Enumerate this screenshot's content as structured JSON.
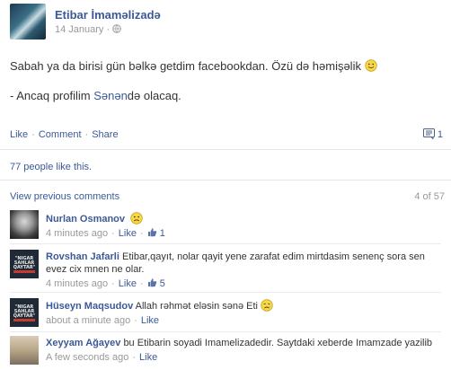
{
  "post": {
    "author": "Etibar İmaməlizadə",
    "date": "14 January",
    "meta_sep": "·",
    "line1": "Sabah ya da birisi gün bəlkə getdim facebookdan. Özü də həmişəlik",
    "line2_pre": "- Ancaq profilim ",
    "line2_mention": "Sənən",
    "line2_post": "də olacaq."
  },
  "actions": {
    "like": "Like",
    "comment": "Comment",
    "share": "Share",
    "sep": "·",
    "comment_count": "1"
  },
  "likes_text": "77 people like this.",
  "comments_header": {
    "view_previous": "View previous comments",
    "count": "4 of 57"
  },
  "comments": [
    {
      "name": "Nurlan Osmanov",
      "text": "",
      "time": "4 minutes ago",
      "like": "Like",
      "likes": "1"
    },
    {
      "name": "Rovshan Jafarli",
      "text": "Etibar,qayıt, nolar qayit yene zarafat edim mirtdasim senenç sora sen evez cix mnen ne olar.",
      "time": "4 minutes ago",
      "like": "Like",
      "likes": "5",
      "avatar_text": "\"NIGAR SAHLAR QAYTAR\""
    },
    {
      "name": "Hüseyn Maqsudov",
      "text": "Allah rəhmət eləsin sənə Eti",
      "time": "about a minute ago",
      "like": "Like",
      "avatar_text": "\"NIGAR SAHLAR QAYTAR\""
    },
    {
      "name": "Xeyyam Ağayev",
      "text": "bu Etibarin soyadi Imamelizadedir. Saytdaki xeberde Imamzade yazilib",
      "time": "A few seconds ago",
      "like": "Like"
    }
  ],
  "colors": {
    "link": "#3b5998",
    "meta": "#999999",
    "text": "#333333"
  }
}
